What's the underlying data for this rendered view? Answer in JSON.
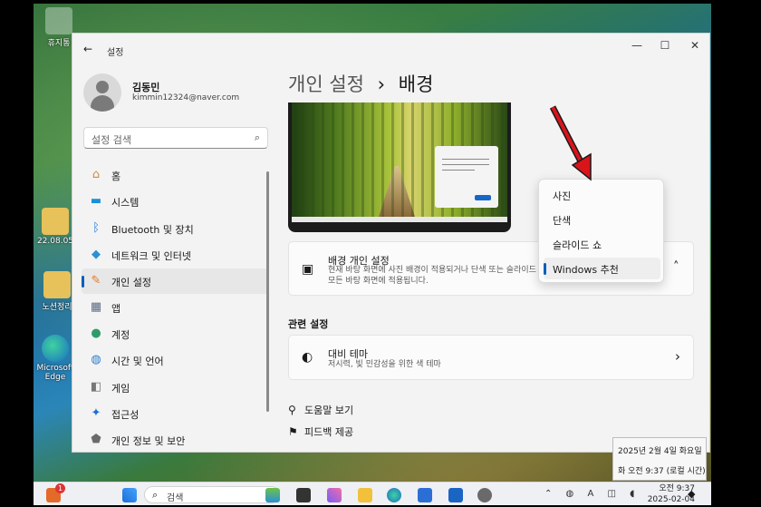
{
  "desktop": {
    "icons": [
      {
        "label": "휴지통",
        "name": "recycle-bin"
      },
      {
        "label": "22.08.05",
        "name": "folder-1"
      },
      {
        "label": "노션정리",
        "name": "folder-2"
      },
      {
        "label": "Microsoft Edge",
        "name": "edge"
      }
    ]
  },
  "window": {
    "title": "설정",
    "controls": {
      "minimize": "—",
      "maximize": "☐",
      "close": "✕"
    },
    "back": "←"
  },
  "user": {
    "name": "김동민",
    "email": "kimmin12324@naver.com"
  },
  "search": {
    "placeholder": "설정 검색",
    "icon": "⌕"
  },
  "nav": [
    {
      "label": "홈",
      "icon": "home-icon",
      "glyph": "⌂",
      "color": "#d08a3c"
    },
    {
      "label": "시스템",
      "icon": "system-icon",
      "glyph": "▬",
      "color": "#1e8fd6"
    },
    {
      "label": "Bluetooth 및 장치",
      "icon": "bluetooth-icon",
      "glyph": "ᛒ",
      "color": "#1e7ad6"
    },
    {
      "label": "네트워크 및 인터넷",
      "icon": "wifi-icon",
      "glyph": "◆",
      "color": "#2d8fd6"
    },
    {
      "label": "개인 설정",
      "icon": "brush-icon",
      "glyph": "✎",
      "color": "#e07a2c",
      "selected": true
    },
    {
      "label": "앱",
      "icon": "apps-icon",
      "glyph": "▦",
      "color": "#5a6a82"
    },
    {
      "label": "계정",
      "icon": "account-icon",
      "glyph": "●",
      "color": "#2e9c6a"
    },
    {
      "label": "시간 및 언어",
      "icon": "globe-icon",
      "glyph": "◍",
      "color": "#2d7fc9"
    },
    {
      "label": "게임",
      "icon": "gamepad-icon",
      "glyph": "◧",
      "color": "#777"
    },
    {
      "label": "접근성",
      "icon": "accessibility-icon",
      "glyph": "✦",
      "color": "#1e6fd6"
    },
    {
      "label": "개인 정보 및 보안",
      "icon": "shield-icon",
      "glyph": "⬟",
      "color": "#6a6a6a"
    }
  ],
  "page": {
    "breadcrumb": "개인 설정",
    "separator": "›",
    "title": "배경"
  },
  "background_card": {
    "title": "배경 개인 설정",
    "desc": "현재 바탕 화면에 사진 배경이 적용되거나 단색 또는 슬라이드 쇼 배경이 모든 바탕 화면에 적용됩니다.",
    "chevron": "˄"
  },
  "dropdown": {
    "options": [
      "사진",
      "단색",
      "슬라이드 쇼",
      "Windows 추천"
    ],
    "selected_index": 3
  },
  "related": {
    "title": "관련 설정",
    "contrast_title": "대비 테마",
    "contrast_desc": "저시력, 빛 민감성을 위한 색 테마",
    "chevron": "›"
  },
  "links": [
    {
      "label": "도움말 보기",
      "icon": "help-icon"
    },
    {
      "label": "피드백 제공",
      "icon": "feedback-icon"
    }
  ],
  "taskbar": {
    "search_label": "검색",
    "clock_time": "오전 9:37",
    "clock_date": "2025-02-04",
    "badge": "1"
  },
  "tooltip": {
    "line1": "2025년 2월 4일 화요일",
    "line2": "화 오전 9:37 (로컬 시간)"
  },
  "colors": {
    "accent": "#005fb8",
    "arrow": "#d9141a"
  }
}
